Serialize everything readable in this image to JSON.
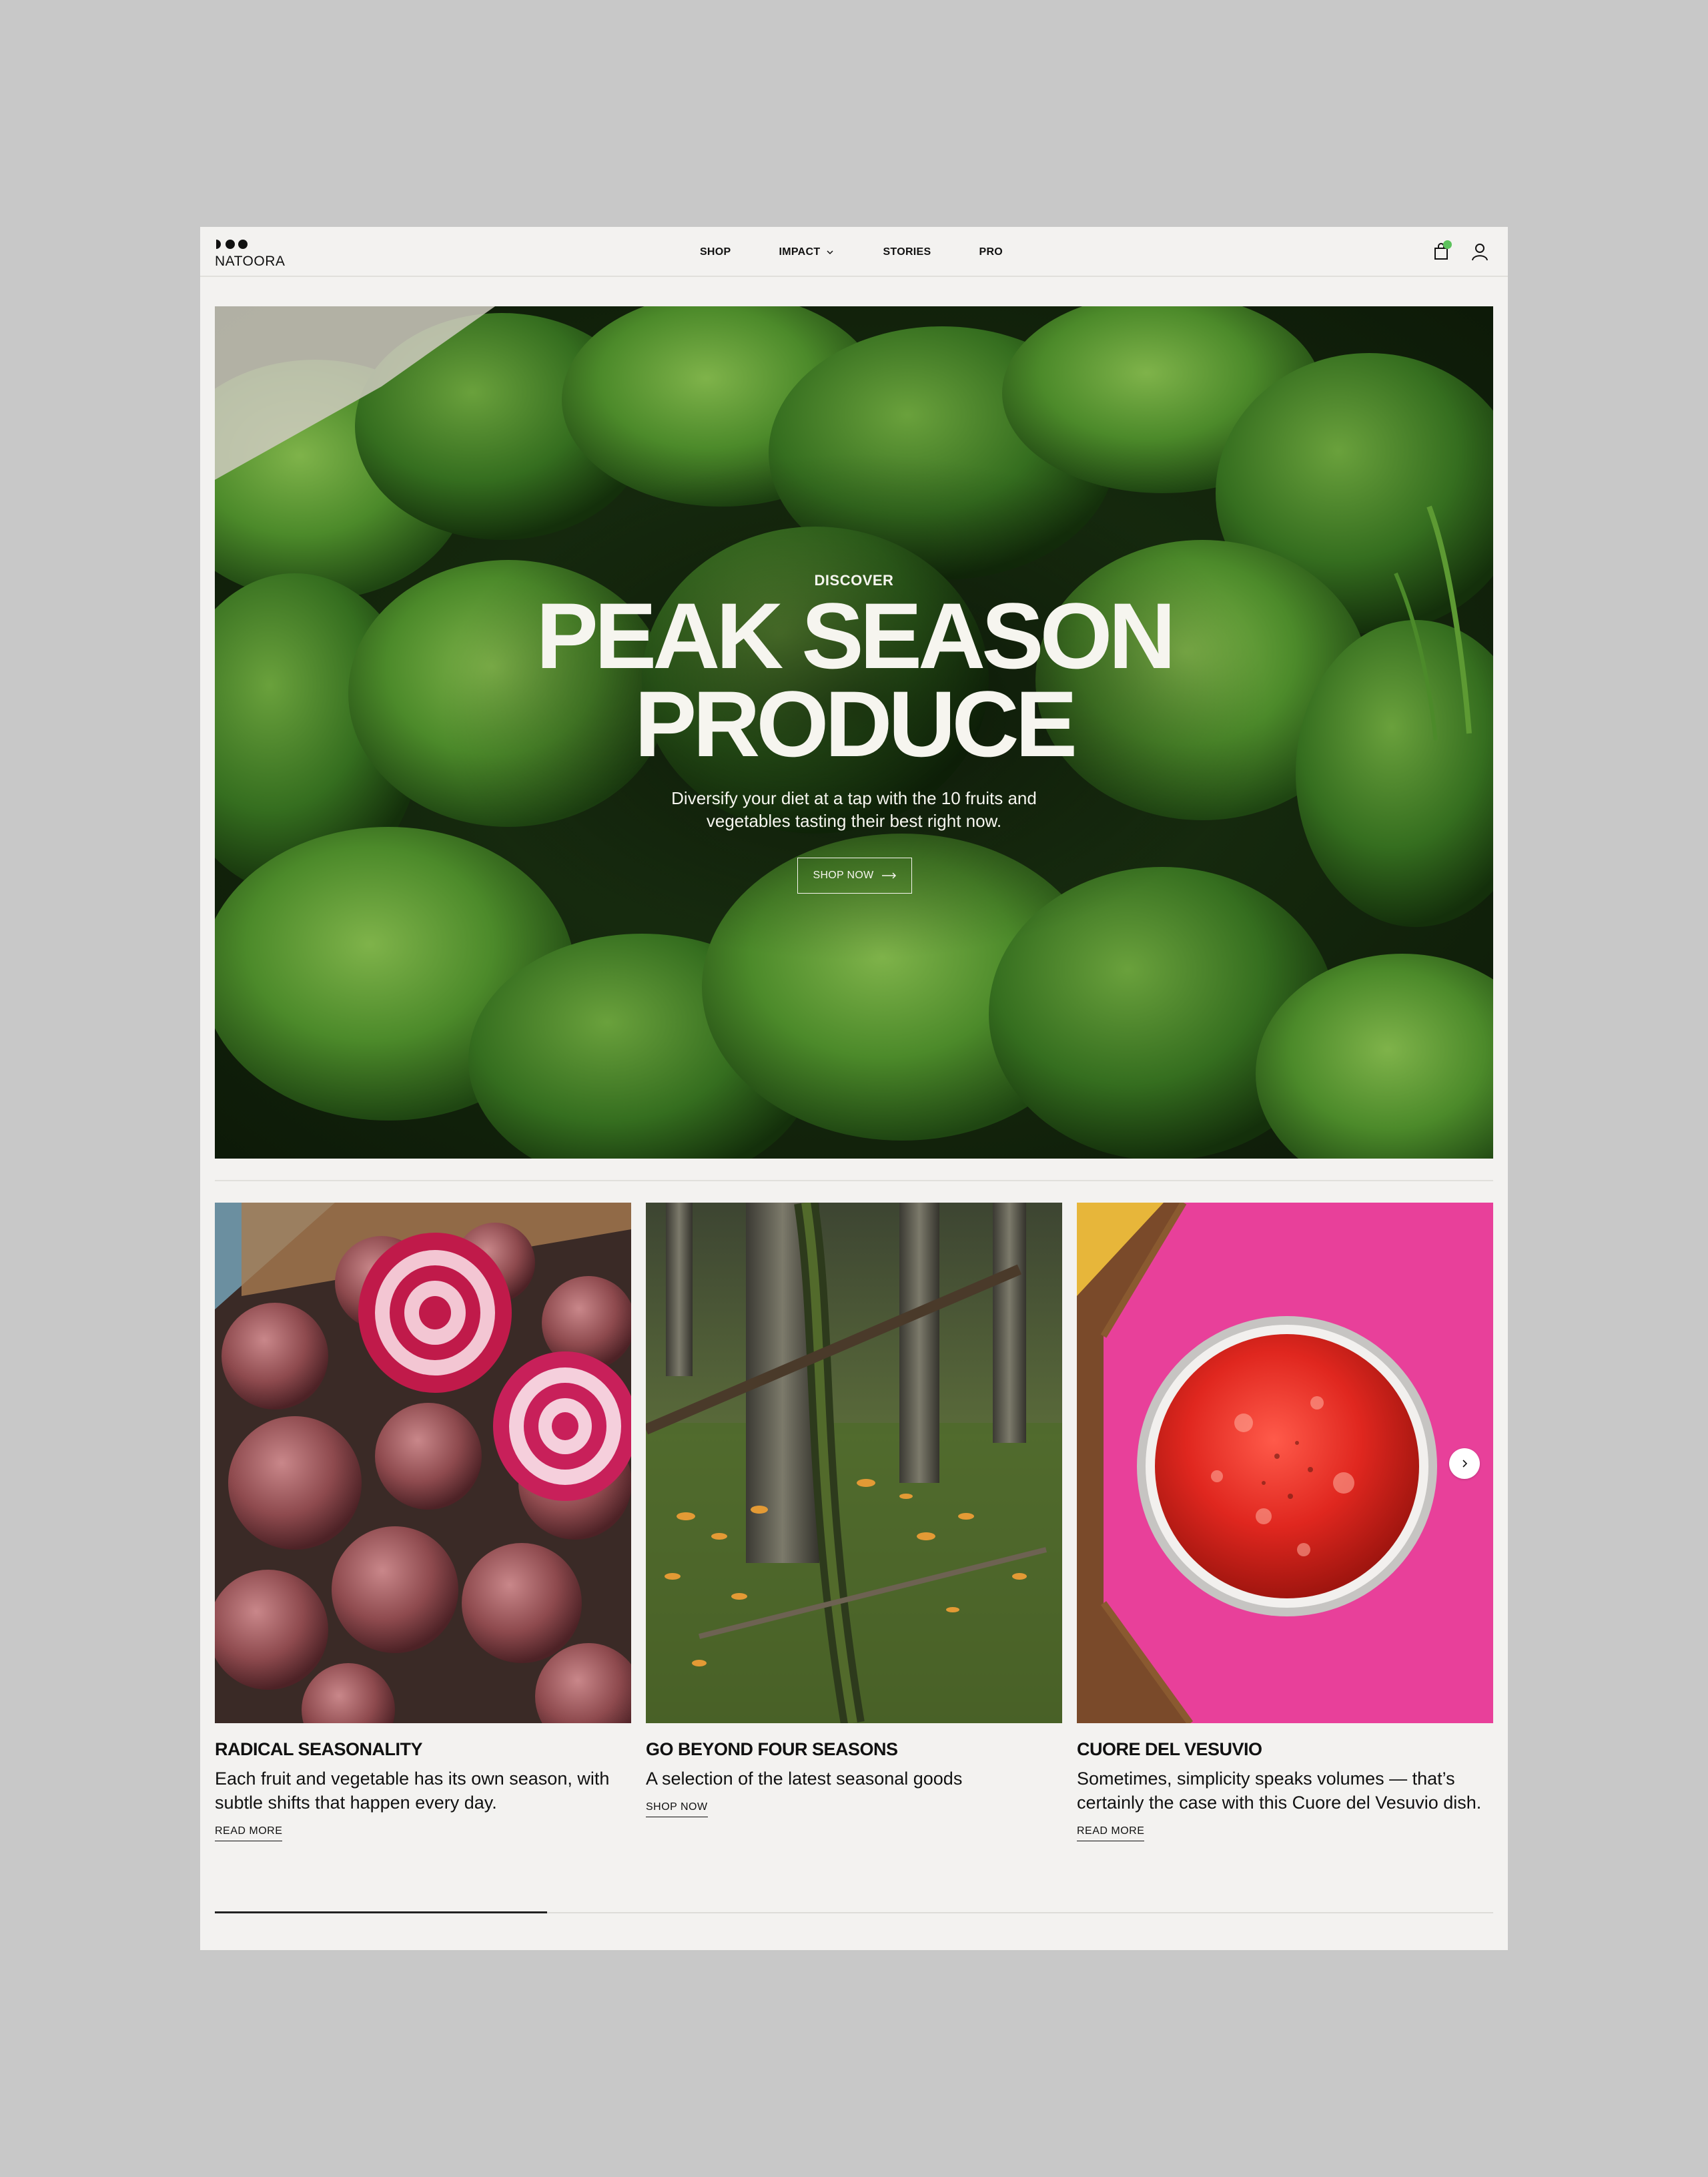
{
  "brand": {
    "name": "NATOORA"
  },
  "nav": {
    "items": [
      {
        "label": "SHOP"
      },
      {
        "label": "IMPACT"
      },
      {
        "label": "STORIES"
      },
      {
        "label": "PRO"
      }
    ]
  },
  "header": {
    "cart_icon": "shopping-bag-icon",
    "account_icon": "user-icon",
    "cart_indicator_color": "#5cc25c"
  },
  "hero": {
    "eyebrow": "DISCOVER",
    "title_line1": "PEAK SEASON",
    "title_line2": "PRODUCE",
    "subtitle": "Diversify your diet at a tap with the 10 fruits and vegetables tasting their best right now.",
    "button_label": "SHOP NOW"
  },
  "cards": [
    {
      "title": "RADICAL SEASONALITY",
      "description": "Each fruit and vegetable has its own season, with subtle shifts that happen every day.",
      "link": "READ MORE"
    },
    {
      "title": "GO BEYOND FOUR SEASONS",
      "description": "A selection of the latest seasonal goods",
      "link": "SHOP NOW"
    },
    {
      "title": "CUORE DEL VESUVIO",
      "description": "Sometimes, simplicity speaks volumes — that’s certainly the case with this Cuore del Vesuvio dish.",
      "link": "READ MORE"
    }
  ],
  "carousel": {
    "next_icon": "chevron-right-icon",
    "progress": 0.26
  }
}
